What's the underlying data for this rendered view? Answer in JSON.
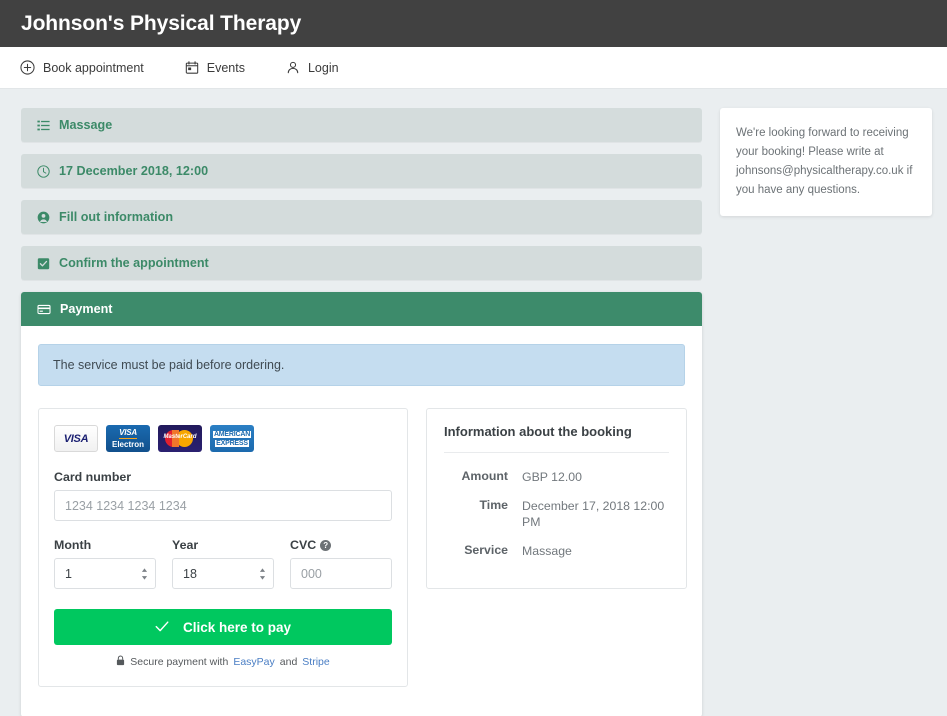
{
  "header": {
    "brand_title": "Johnson's Physical Therapy",
    "bar_color": "#414141"
  },
  "nav": {
    "items": [
      {
        "label": "Book appointment",
        "icon": "plus-circle-icon"
      },
      {
        "label": "Events",
        "icon": "calendar-icon"
      },
      {
        "label": "Login",
        "icon": "user-icon"
      }
    ]
  },
  "steps": [
    {
      "label": "Massage",
      "icon": "list-icon",
      "state": "collapsed"
    },
    {
      "label": "17 December 2018, 12:00",
      "icon": "clock-icon",
      "state": "collapsed"
    },
    {
      "label": "Fill out information",
      "icon": "user-circle-icon",
      "state": "collapsed"
    },
    {
      "label": "Confirm the appointment",
      "icon": "check-square-icon",
      "state": "collapsed"
    }
  ],
  "payment": {
    "header_label": "Payment",
    "header_icon": "credit-card-icon",
    "header_color": "#3d8b6b",
    "alert_text": "The service must be paid before ordering.",
    "brands": [
      {
        "name": "visa-logo",
        "text": "VISA"
      },
      {
        "name": "visa-electron-logo",
        "line1": "VISA",
        "line2": "Electron"
      },
      {
        "name": "mastercard-logo",
        "text": "MasterCard"
      },
      {
        "name": "amex-logo",
        "line1": "AMERICAN",
        "line2": "EXPRESS"
      }
    ],
    "card_number": {
      "label": "Card number",
      "placeholder": "1234 1234 1234 1234",
      "value": ""
    },
    "month": {
      "label": "Month",
      "value": "1"
    },
    "year": {
      "label": "Year",
      "value": "18"
    },
    "cvc": {
      "label": "CVC",
      "placeholder": "000",
      "value": "",
      "help_icon": "question-mark-icon"
    },
    "pay_button": {
      "label": "Click here to pay",
      "icon": "check-icon",
      "color": "#00c85f"
    },
    "secure": {
      "icon": "lock-icon",
      "prefix": "Secure payment with",
      "link1": "EasyPay",
      "conjunction": "and",
      "link2": "Stripe",
      "link_color": "#4a7ec4"
    }
  },
  "booking_info": {
    "title": "Information about the booking",
    "rows": [
      {
        "key": "Amount",
        "value": "GBP 12.00"
      },
      {
        "key": "Time",
        "value": "December 17, 2018 12:00 PM"
      },
      {
        "key": "Service",
        "value": "Massage"
      }
    ]
  },
  "sidebar_note": {
    "text": "We're looking forward to receiving your booking!\nPlease write at johnsons@physicaltherapy.co.uk if you have any questions."
  }
}
